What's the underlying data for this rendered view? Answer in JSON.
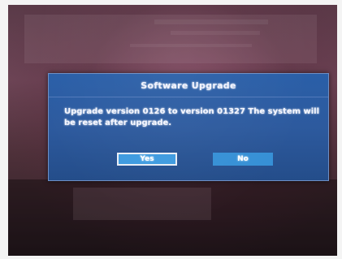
{
  "dialog": {
    "title": "Software Upgrade",
    "message": "Upgrade version 0126 to version 01327 The system will be reset after upgrade.",
    "buttons": {
      "yes_label": "Yes",
      "no_label": "No"
    },
    "selected_button": "Yes"
  },
  "colors": {
    "dialog_background": "#2d5a9e",
    "button_background": "#3690d6",
    "selected_button_border": "#e9eef6",
    "text": "#f4f6ff"
  }
}
